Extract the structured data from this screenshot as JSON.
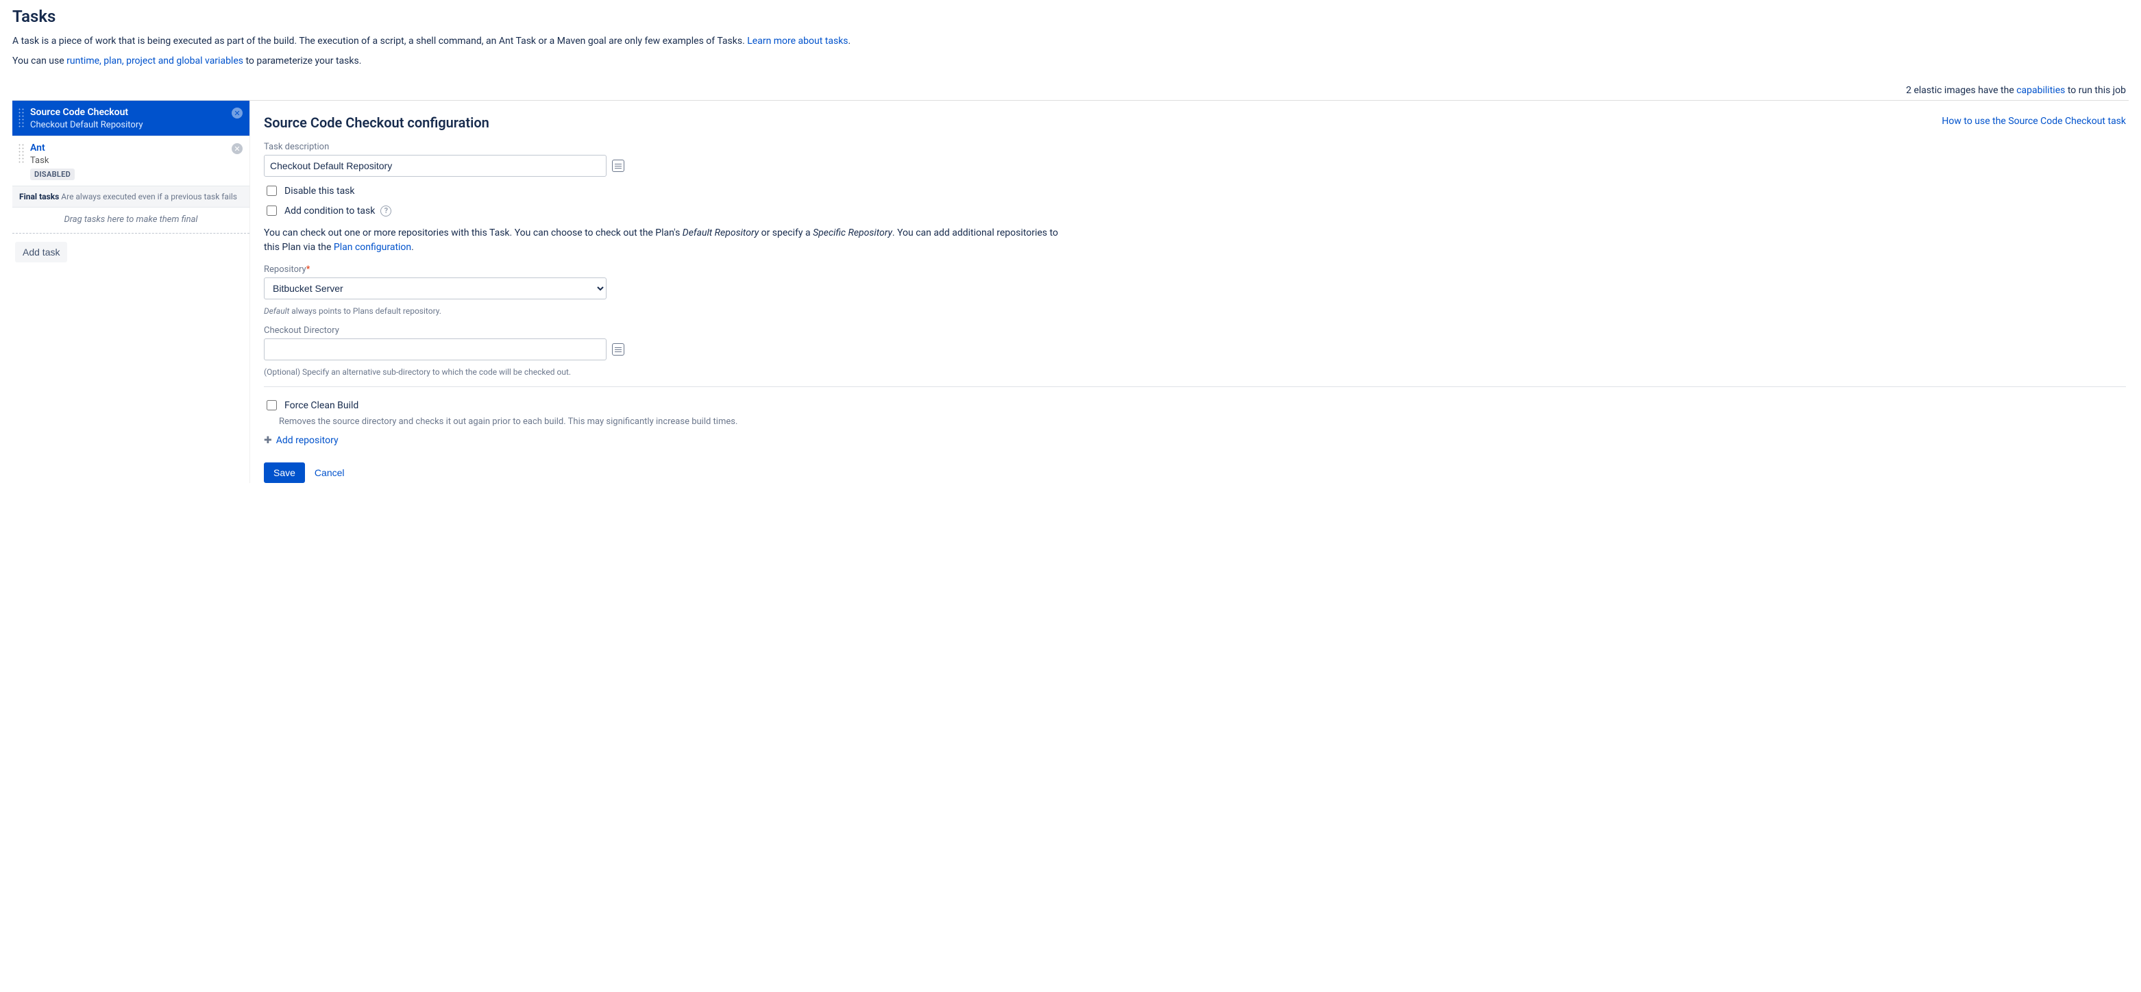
{
  "header": {
    "title": "Tasks",
    "intro_pre": "A task is a piece of work that is being executed as part of the build. The execution of a script, a shell command, an Ant Task or a Maven goal are only few examples of Tasks. ",
    "intro_link": "Learn more about tasks",
    "intro_post": ".",
    "param_pre": "You can use ",
    "param_link": "runtime, plan, project and global variables",
    "param_post": " to parameterize your tasks.",
    "elastic_pre": "2 elastic images have the ",
    "elastic_link": "capabilities",
    "elastic_post": " to run this job"
  },
  "tasks": {
    "item0": {
      "title": "Source Code Checkout",
      "sub": "Checkout Default Repository"
    },
    "item1": {
      "title": "Ant",
      "sub": "Task",
      "disabled": "DISABLED"
    },
    "final_label": "Final tasks",
    "final_desc": "Are always executed even if a previous task fails",
    "drop_hint": "Drag tasks here to make them final",
    "add_task": "Add task"
  },
  "panel": {
    "title": "Source Code Checkout configuration",
    "how_link": "How to use the Source Code Checkout task",
    "desc_label": "Task description",
    "desc_value": "Checkout Default Repository",
    "disable_label": "Disable this task",
    "condition_label": "Add condition to task",
    "repo_para_a": "You can check out one or more repositories with this Task. You can choose to check out the Plan's ",
    "repo_para_em1": "Default Repository",
    "repo_para_b": " or specify a ",
    "repo_para_em2": "Specific Repository",
    "repo_para_c": ". You can add additional repositories to this Plan via the ",
    "repo_para_link": "Plan configuration",
    "repo_para_d": ".",
    "repo_label": "Repository",
    "repo_value": "Bitbucket Server",
    "repo_hint_em": "Default",
    "repo_hint_rest": " always points to Plans default repository.",
    "dir_label": "Checkout Directory",
    "dir_value": "",
    "dir_hint": "(Optional) Specify an alternative sub-directory to which the code will be checked out.",
    "force_label": "Force Clean Build",
    "force_hint": "Removes the source directory and checks it out again prior to each build. This may significantly increase build times.",
    "add_repo": "Add repository",
    "save": "Save",
    "cancel": "Cancel"
  }
}
